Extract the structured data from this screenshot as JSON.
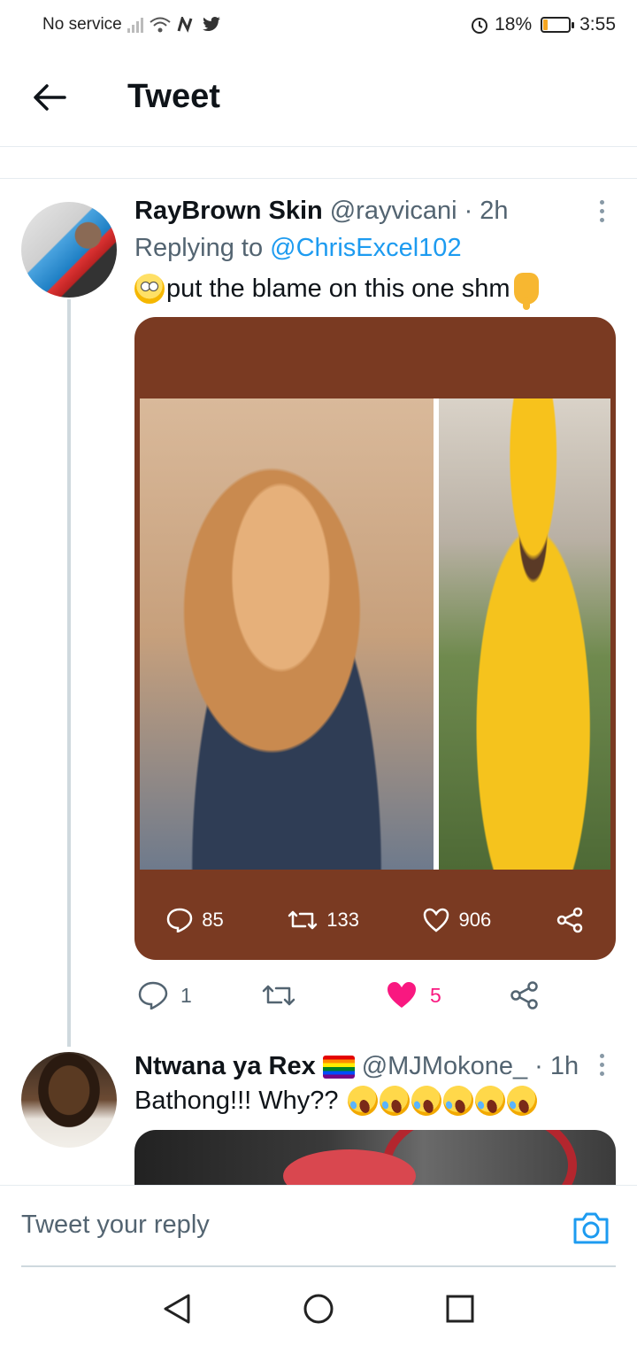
{
  "status_bar": {
    "carrier": "No service",
    "battery": "18%",
    "battery_level": 0.18,
    "time": "3:55",
    "accent": "#f5a623"
  },
  "header": {
    "back_icon": "arrow-left-icon",
    "title": "Tweet"
  },
  "tweets": [
    {
      "name": "RayBrown Skin",
      "handle": "@rayvicani",
      "time": "· 2h",
      "replying_prefix": "Replying to",
      "replying_handle": "@ChrisExcel102",
      "text": "put the blame on this one shm",
      "media_stats": {
        "replies": "85",
        "retweets": "133",
        "likes": "906"
      },
      "actions": {
        "replies": "1",
        "likes": "5",
        "liked": true
      }
    },
    {
      "name": "Ntwana ya Rex",
      "handle": "@MJMokone_",
      "time": "· 1h",
      "text": "Bathong!!! Why??"
    }
  ],
  "reply_bar": {
    "placeholder": "Tweet your reply"
  },
  "colors": {
    "link": "#1d9bf0",
    "like": "#f91880",
    "media_bg": "#7a3a22",
    "secondary_text": "#536471"
  }
}
